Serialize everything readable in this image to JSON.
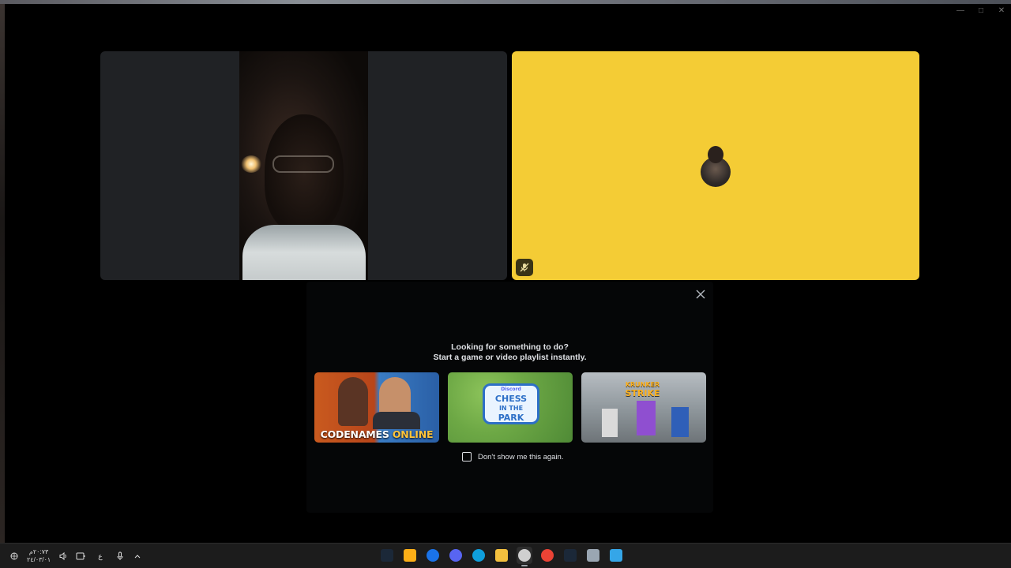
{
  "window": {
    "controls": [
      "minimize",
      "maximize",
      "close"
    ]
  },
  "stage": {
    "tiles": [
      {
        "type": "camera"
      },
      {
        "type": "voice",
        "background": "#f4cc35",
        "muted": true
      }
    ]
  },
  "activity_prompt": {
    "line1": "Looking for something to do?",
    "line2": "Start a game or video playlist instantly.",
    "cards": [
      {
        "brand": "CODENAMES",
        "highlight": "ONLINE"
      },
      {
        "badge": "Discord",
        "line1": "CHESS",
        "line2": "IN THE",
        "line3": "PARK"
      },
      {
        "line1": "KRUNKER",
        "line2": "STRIKE"
      }
    ],
    "dont_show_label": "Don't show me this again."
  },
  "taskbar": {
    "clock_time": "٢٠:٧٣م",
    "clock_date": "٢٤/٠٣/٠١",
    "language": "ع",
    "tray_icons": [
      "network-icon",
      "volume-icon",
      "battery-icon",
      "language-indicator",
      "mic-icon",
      "chevron-up-icon"
    ],
    "apps": [
      {
        "name": "steam",
        "color": "#1b2838"
      },
      {
        "name": "rockstar",
        "color": "#fcaf17"
      },
      {
        "name": "edge-beta",
        "color": "#1a73e8"
      },
      {
        "name": "discord",
        "color": "#5865f2"
      },
      {
        "name": "edge",
        "color": "#0f9fdc"
      },
      {
        "name": "file-explorer",
        "color": "#f3c03e"
      },
      {
        "name": "clock-app",
        "color": "#cfcfcf",
        "active": true
      },
      {
        "name": "chrome",
        "color": "#ea4335"
      },
      {
        "name": "steam-2",
        "color": "#1b2838"
      },
      {
        "name": "settings",
        "color": "#9aa6b2"
      },
      {
        "name": "windows-start",
        "color": "#35a6e8"
      }
    ]
  }
}
